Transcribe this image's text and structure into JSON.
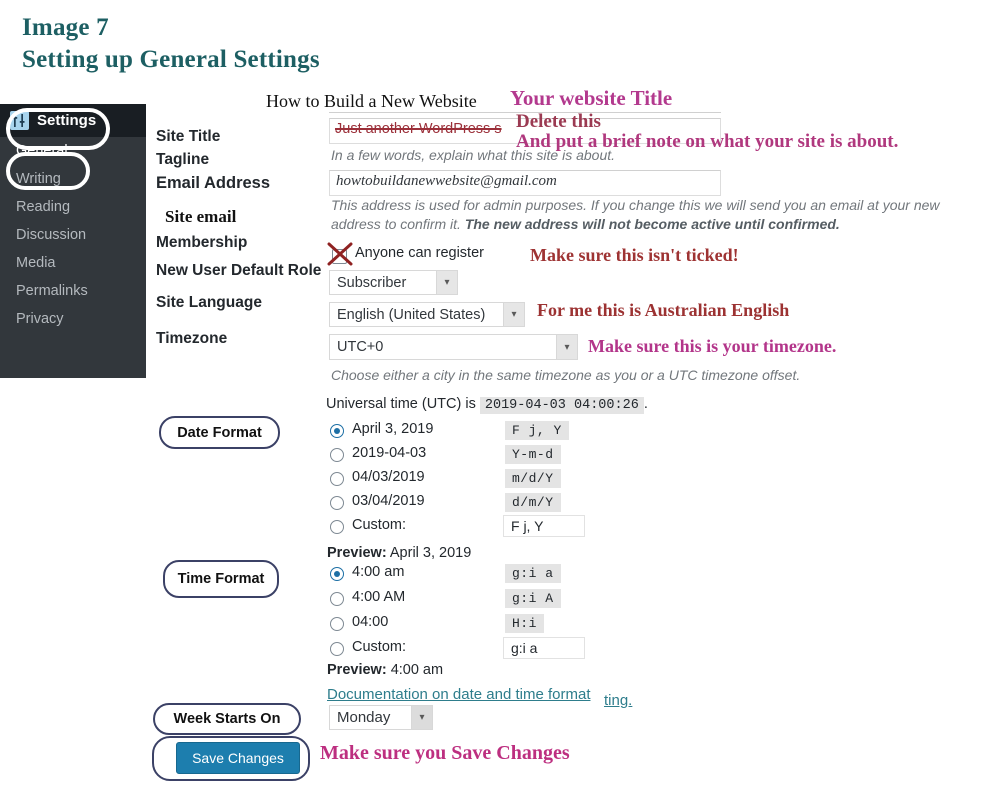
{
  "heading": {
    "line1": "Image 7",
    "line2": "Setting up General Settings",
    "color": "#1d5f63"
  },
  "sidebar": {
    "items": [
      {
        "label": "Settings",
        "icon": "sliders-icon",
        "active": true
      },
      {
        "label": "General",
        "active": true
      },
      {
        "label": "Writing",
        "active": false
      },
      {
        "label": "Reading",
        "active": false
      },
      {
        "label": "Discussion",
        "active": false
      },
      {
        "label": "Media",
        "active": false
      },
      {
        "label": "Permalinks",
        "active": false
      },
      {
        "label": "Privacy",
        "active": false
      }
    ]
  },
  "form": {
    "labels": {
      "site_title": "Site Title",
      "tagline": "Tagline",
      "email_address": "Email Address",
      "site_email_note": "Site email",
      "membership": "Membership",
      "new_user_default_role": "New User Default Role",
      "site_language": "Site Language",
      "timezone": "Timezone"
    },
    "site_title_value": "How to Build a New Website",
    "tagline_value": "Just another WordPress s",
    "tagline_help": "In a few words, explain what this site is about.",
    "email_value": "howtobuildanewwebsite@gmail.com",
    "email_help_1": "This address is used for admin purposes. If you change this we will send you an email at your new",
    "email_help_2a": "address to confirm it. ",
    "email_help_2b": "The new address will not become active until confirmed.",
    "membership_checkbox_label": "Anyone can register",
    "membership_checked": false,
    "new_user_default_role_value": "Subscriber",
    "site_language_value": "English (United States)",
    "timezone_value": "UTC+0",
    "timezone_help": "Choose either a city in the same timezone as you or a UTC timezone offset.",
    "utc_prefix": "Universal time (UTC) is",
    "utc_value": "2019-04-03 04:00:26",
    "utc_suffix": "."
  },
  "date_format": {
    "callout": "Date Format",
    "options": [
      {
        "label": "April 3, 2019",
        "code": "F j, Y",
        "selected": true
      },
      {
        "label": "2019-04-03",
        "code": "Y-m-d",
        "selected": false
      },
      {
        "label": "04/03/2019",
        "code": "m/d/Y",
        "selected": false
      },
      {
        "label": "03/04/2019",
        "code": "d/m/Y",
        "selected": false
      },
      {
        "label": "Custom:",
        "code": "F j, Y",
        "selected": false,
        "is_input": true
      }
    ],
    "preview_label": "Preview:",
    "preview_value": "April 3, 2019"
  },
  "time_format": {
    "callout": "Time Format",
    "options": [
      {
        "label": "4:00 am",
        "code": "g:i a",
        "selected": true
      },
      {
        "label": "4:00 AM",
        "code": "g:i A",
        "selected": false
      },
      {
        "label": "04:00",
        "code": "H:i",
        "selected": false
      },
      {
        "label": "Custom:",
        "code": "g:i a",
        "selected": false,
        "is_input": true
      }
    ],
    "preview_label": "Preview:",
    "preview_value": "4:00 am"
  },
  "doc_link": {
    "text": "Documentation on date and time format",
    "tail": "ting."
  },
  "week": {
    "callout": "Week Starts On",
    "value": "Monday"
  },
  "save": {
    "callout_hidden": "",
    "label": "Save Changes"
  },
  "annotations": {
    "site_title": "Your website Title",
    "delete_this": "Delete this",
    "brief_note": "And put a brief note on what your site is about.",
    "not_ticked": "Make sure this isn't ticked!",
    "language": "For me this is Australian English",
    "timezone": "Make sure this is your timezone.",
    "save": "Make sure you Save Changes"
  },
  "colors": {
    "heading_teal": "#1d5f63",
    "sidebar_bg": "#32373c",
    "sidebar_active_bg": "#191e23",
    "save_button_blue": "#1d7eae",
    "callout_navy": "#3b4166",
    "annotation_magenta": "#b3398e",
    "annotation_red": "#9e3333",
    "link_teal": "#2e7d8c"
  }
}
